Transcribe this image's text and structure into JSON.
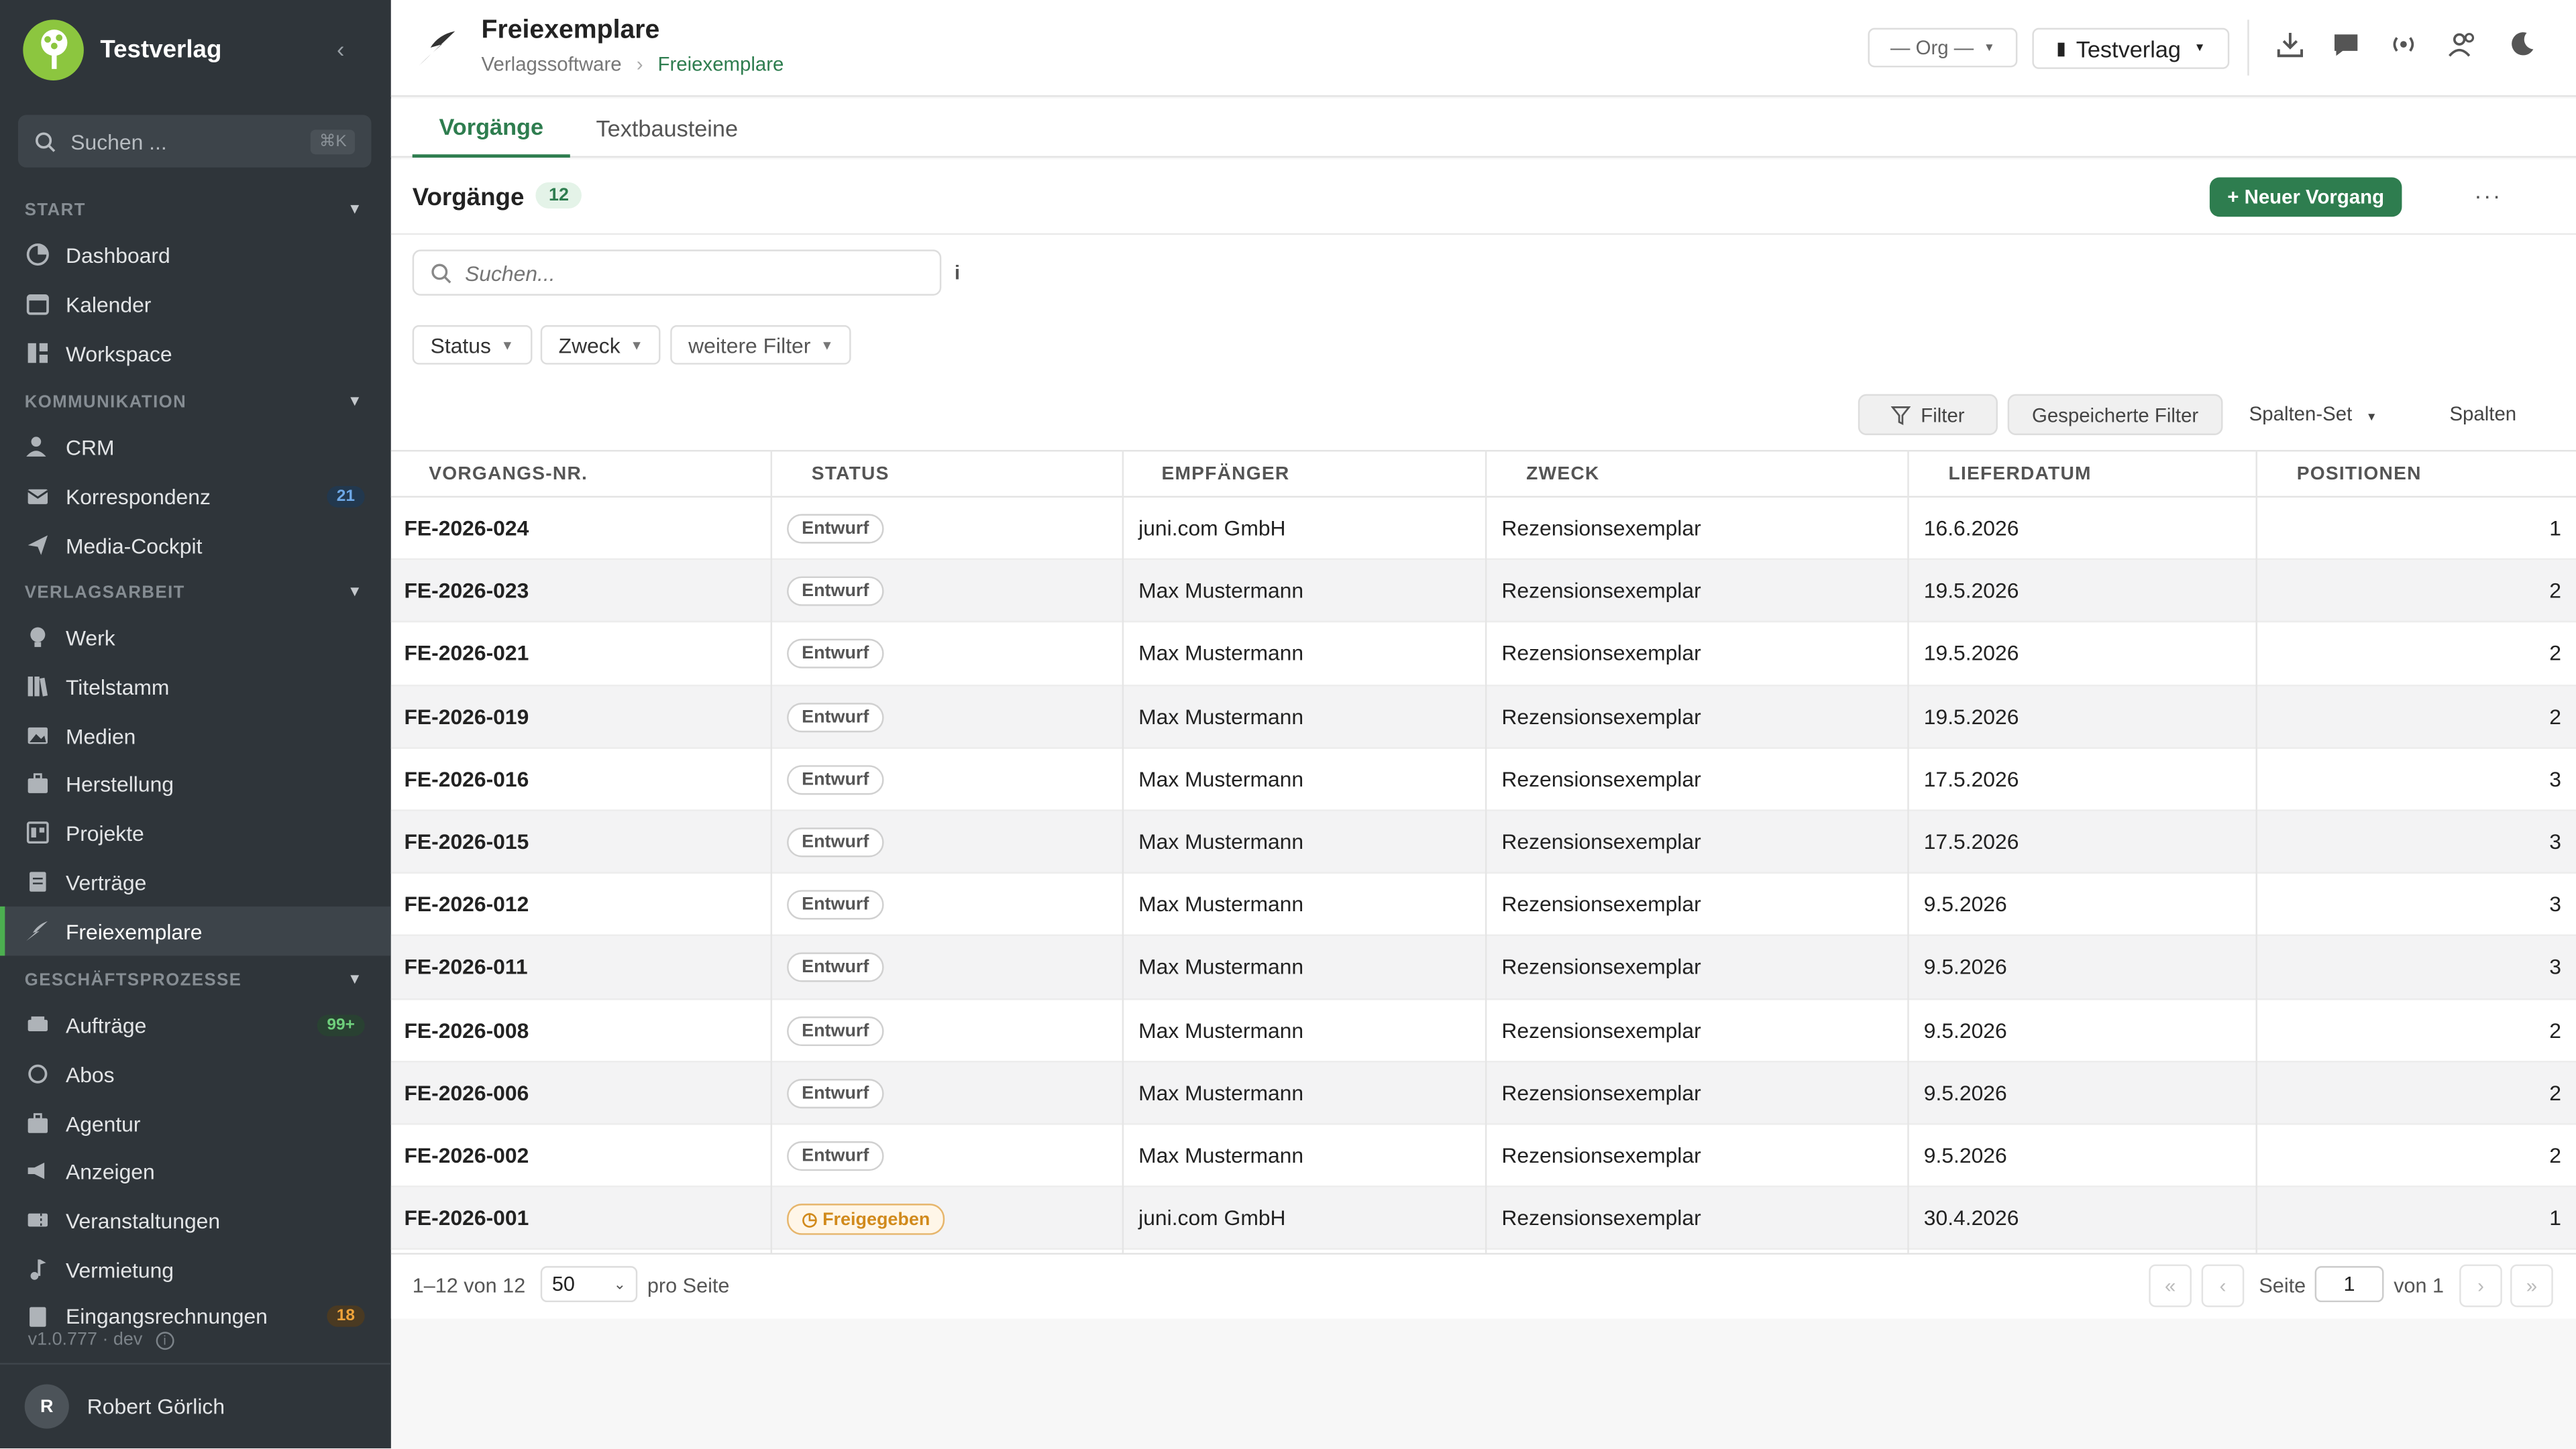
{
  "sidebar": {
    "brand": "Testverlag",
    "search_placeholder": "Suchen ...",
    "search_shortcut": "⌘K",
    "sections": {
      "start": "START",
      "kommunikation": "KOMMUNIKATION",
      "verlagsarbeit": "VERLAGSARBEIT",
      "geschaeft": "GESCHÄFTSPROZESSE"
    },
    "items": {
      "dashboard": "Dashboard",
      "kalender": "Kalender",
      "workspace": "Workspace",
      "crm": "CRM",
      "korrespondenz": "Korrespondenz",
      "korrespondenz_badge": "21",
      "media": "Media-Cockpit",
      "werk": "Werk",
      "titelstamm": "Titelstamm",
      "medien": "Medien",
      "herstellung": "Herstellung",
      "projekte": "Projekte",
      "vertraege": "Verträge",
      "freiexemplare": "Freiexemplare",
      "auftraege": "Aufträge",
      "auftraege_badge": "99+",
      "abos": "Abos",
      "agentur": "Agentur",
      "anzeigen": "Anzeigen",
      "veranstaltungen": "Veranstaltungen",
      "vermietung": "Vermietung",
      "eingangsrechnungen": "Eingangsrechnungen",
      "eingangsrechnungen_badge": "18"
    },
    "version": "v1.0.777 · dev",
    "user_initial": "R",
    "user_name": "Robert Görlich"
  },
  "header": {
    "title": "Freiexemplare",
    "crumb_root": "Verlagssoftware",
    "crumb_current": "Freiexemplare",
    "org_select": "— Org —",
    "verlag_select": "Testverlag"
  },
  "tabs": {
    "vorgaenge": "Vorgänge",
    "textbausteine": "Textbausteine"
  },
  "list": {
    "title": "Vorgänge",
    "count": "12",
    "new_button": "+ Neuer Vorgang",
    "more": "···",
    "search_placeholder": "Suchen...",
    "info": "i",
    "filter_status": "Status",
    "filter_zweck": "Zweck",
    "filter_more": "weitere Filter",
    "btn_filter": "Filter",
    "btn_saved": "Gespeicherte Filter",
    "link_spaltenset": "Spalten-Set",
    "link_spalten": "Spalten"
  },
  "table": {
    "headers": [
      "VORGANGS-NR.",
      "STATUS",
      "EMPFÄNGER",
      "ZWECK",
      "LIEFERDATUM",
      "POSITIONEN"
    ],
    "rows": [
      {
        "nr": "FE-2026-024",
        "status": "Entwurf",
        "empf": "juni.com GmbH",
        "zweck": "Rezensionsexemplar",
        "datum": "16.6.2026",
        "pos": "1"
      },
      {
        "nr": "FE-2026-023",
        "status": "Entwurf",
        "empf": "Max Mustermann",
        "zweck": "Rezensionsexemplar",
        "datum": "19.5.2026",
        "pos": "2"
      },
      {
        "nr": "FE-2026-021",
        "status": "Entwurf",
        "empf": "Max Mustermann",
        "zweck": "Rezensionsexemplar",
        "datum": "19.5.2026",
        "pos": "2"
      },
      {
        "nr": "FE-2026-019",
        "status": "Entwurf",
        "empf": "Max Mustermann",
        "zweck": "Rezensionsexemplar",
        "datum": "19.5.2026",
        "pos": "2"
      },
      {
        "nr": "FE-2026-016",
        "status": "Entwurf",
        "empf": "Max Mustermann",
        "zweck": "Rezensionsexemplar",
        "datum": "17.5.2026",
        "pos": "3"
      },
      {
        "nr": "FE-2026-015",
        "status": "Entwurf",
        "empf": "Max Mustermann",
        "zweck": "Rezensionsexemplar",
        "datum": "17.5.2026",
        "pos": "3"
      },
      {
        "nr": "FE-2026-012",
        "status": "Entwurf",
        "empf": "Max Mustermann",
        "zweck": "Rezensionsexemplar",
        "datum": "9.5.2026",
        "pos": "3"
      },
      {
        "nr": "FE-2026-011",
        "status": "Entwurf",
        "empf": "Max Mustermann",
        "zweck": "Rezensionsexemplar",
        "datum": "9.5.2026",
        "pos": "3"
      },
      {
        "nr": "FE-2026-008",
        "status": "Entwurf",
        "empf": "Max Mustermann",
        "zweck": "Rezensionsexemplar",
        "datum": "9.5.2026",
        "pos": "2"
      },
      {
        "nr": "FE-2026-006",
        "status": "Entwurf",
        "empf": "Max Mustermann",
        "zweck": "Rezensionsexemplar",
        "datum": "9.5.2026",
        "pos": "2"
      },
      {
        "nr": "FE-2026-002",
        "status": "Entwurf",
        "empf": "Max Mustermann",
        "zweck": "Rezensionsexemplar",
        "datum": "9.5.2026",
        "pos": "2"
      },
      {
        "nr": "FE-2026-001",
        "status": "Freigegeben",
        "empf": "juni.com GmbH",
        "zweck": "Rezensionsexemplar",
        "datum": "30.4.2026",
        "pos": "1"
      }
    ]
  },
  "footer": {
    "range": "1–12 von 12",
    "page_size": "50",
    "per_page": "pro Seite",
    "first": "«",
    "prev": "‹",
    "page_label": "Seite",
    "page": "1",
    "of": "von 1",
    "next": "›",
    "last": "»"
  },
  "colors": {
    "accent": "#2e7d4f",
    "sidebar": "#2f353a",
    "released": "#d18a1c"
  }
}
